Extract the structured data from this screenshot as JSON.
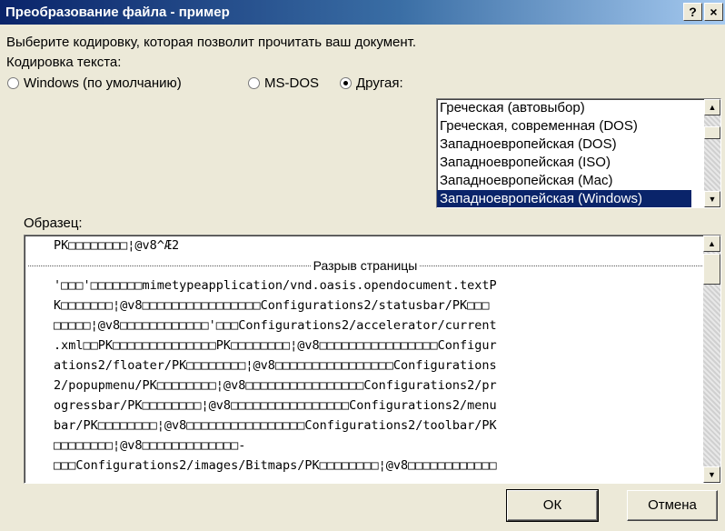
{
  "window": {
    "title": "Преобразование файла - пример",
    "help_label": "?",
    "close_label": "×"
  },
  "prompt": "Выберите кодировку, которая позволит прочитать ваш документ.",
  "encoding_label": "Кодировка текста:",
  "radios": [
    {
      "label": "Windows (по умолчанию)",
      "checked": false
    },
    {
      "label": "MS-DOS",
      "checked": false
    },
    {
      "label": "Другая:",
      "checked": true
    }
  ],
  "encodings": [
    "Греческая (автовыбор)",
    "Греческая, современная (DOS)",
    "Западноевропейская (DOS)",
    "Западноевропейская (ISO)",
    "Западноевропейская (Mac)",
    "Западноевропейская (Windows)"
  ],
  "selected_encoding": "Западноевропейская (Windows)",
  "sample_label": "Образец:",
  "sample": {
    "first_line": "PK□□□□□□□□¦@v8^Æ2",
    "page_break": "Разрыв страницы",
    "lines": [
      "'□□□'□□□□□□□mimetypeapplication/vnd.oasis.opendocument.textP",
      "K□□□□□□□¦@v8□□□□□□□□□□□□□□□□Configurations2/statusbar/PK□□□",
      "□□□□□¦@v8□□□□□□□□□□□□'□□□Configurations2/accelerator/current",
      ".xml□□PK□□□□□□□□□□□□□□PK□□□□□□□□¦@v8□□□□□□□□□□□□□□□□Configur",
      "ations2/floater/PK□□□□□□□□¦@v8□□□□□□□□□□□□□□□□Configurations",
      "2/popupmenu/PK□□□□□□□□¦@v8□□□□□□□□□□□□□□□□Configurations2/pr",
      "ogressbar/PK□□□□□□□□¦@v8□□□□□□□□□□□□□□□□Configurations2/menu",
      "bar/PK□□□□□□□□¦@v8□□□□□□□□□□□□□□□□Configurations2/toolbar/PK",
      "□□□□□□□□¦@v8□□□□□□□□□□□□□-",
      "□□□Configurations2/images/Bitmaps/PK□□□□□□□□¦@v8□□□□□□□□□□□□"
    ]
  },
  "buttons": {
    "ok": "ОК",
    "cancel": "Отмена"
  }
}
